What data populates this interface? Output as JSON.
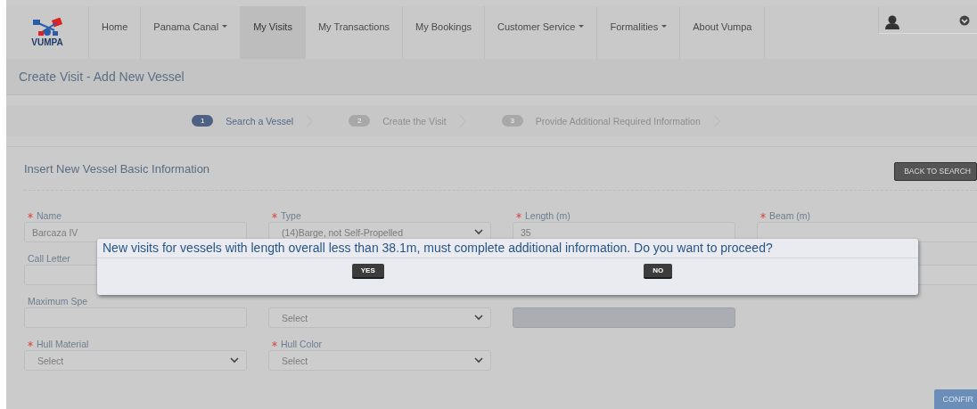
{
  "brand": {
    "name": "VUMPA"
  },
  "nav": [
    {
      "label": "Home",
      "dropdown": false,
      "selected": false
    },
    {
      "label": "Panama Canal",
      "dropdown": true,
      "selected": false
    },
    {
      "label": "My Visits",
      "dropdown": false,
      "selected": true
    },
    {
      "label": "My Transactions",
      "dropdown": false,
      "selected": false
    },
    {
      "label": "My Bookings",
      "dropdown": false,
      "selected": false
    },
    {
      "label": "Customer Service",
      "dropdown": true,
      "selected": false
    },
    {
      "label": "Formalities",
      "dropdown": true,
      "selected": false
    },
    {
      "label": "About Vumpa",
      "dropdown": false,
      "selected": false
    }
  ],
  "page_title": "Create Visit - Add New Vessel",
  "steps": [
    {
      "number": "1",
      "label": "Search a Vessel",
      "selected": true
    },
    {
      "number": "2",
      "label": "Create the Visit",
      "selected": false
    },
    {
      "number": "3",
      "label": "Provide Additional Required Information",
      "selected": false
    }
  ],
  "card": {
    "title": "Insert New Vessel Basic Information",
    "back_button": "BACK TO SEARCH",
    "confirm_button": "CONFIR"
  },
  "form_rows": [
    [
      {
        "kind": "input",
        "label": "Name",
        "required": true,
        "value": "Barcaza IV",
        "disabled": false
      },
      {
        "kind": "select",
        "label": "Type",
        "required": true,
        "value": "(14)Barge, not Self-Propelled",
        "disabled": false
      },
      {
        "kind": "input",
        "label": "Length (m)",
        "required": true,
        "value": "35",
        "disabled": false
      },
      {
        "kind": "input",
        "label": "Beam (m)",
        "required": true,
        "disabled": false
      }
    ],
    [
      {
        "kind": "input",
        "label": "Call Letter",
        "required": false,
        "disabled": false
      },
      {
        "kind": "hidden"
      },
      {
        "kind": "hidden"
      },
      {
        "kind": "input",
        "disabled": false
      }
    ],
    [
      {
        "kind": "input",
        "label": "Maximum Spe",
        "required": false,
        "disabled": false
      },
      {
        "kind": "select",
        "value": "Select",
        "disabled": false
      },
      {
        "kind": "input",
        "disabled": true
      },
      {
        "kind": "empty"
      }
    ],
    [
      {
        "kind": "select",
        "label": "Hull Material",
        "required": true,
        "value": "Select",
        "disabled": false
      },
      {
        "kind": "select",
        "label": "Hull Color",
        "required": true,
        "value": "Select",
        "disabled": false
      },
      {
        "kind": "empty"
      },
      {
        "kind": "empty"
      }
    ]
  ],
  "dialog": {
    "message": "New visits for vessels with length overall less than 38.1m, must complete additional information. Do you want to proceed?",
    "buttons": [
      "YES",
      "NO"
    ]
  }
}
